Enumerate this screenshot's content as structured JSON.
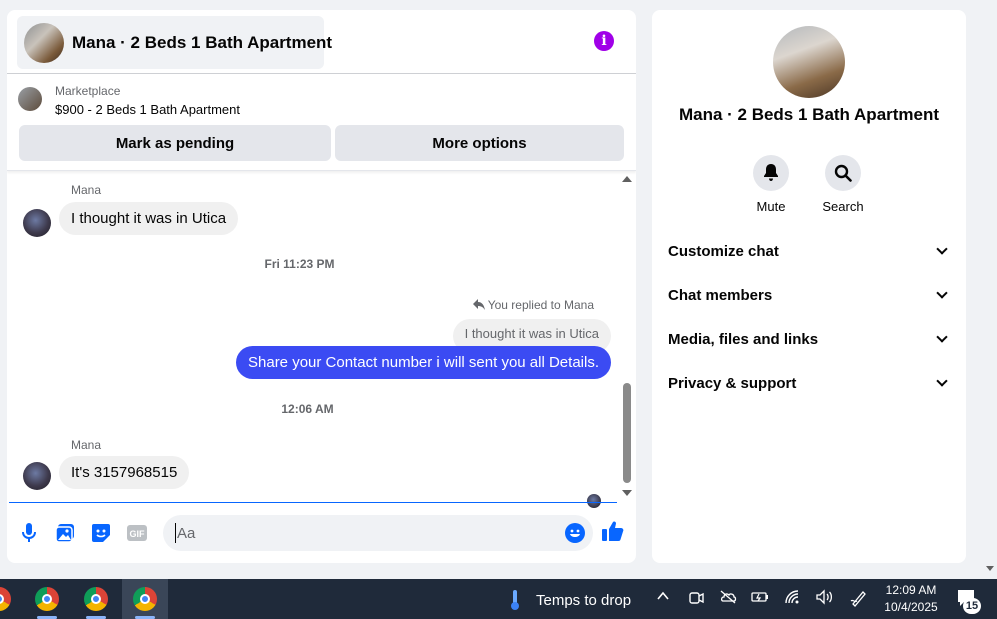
{
  "chat": {
    "title": "Mana · 2 Beds 1 Bath Apartment",
    "marketplace": {
      "label": "Marketplace",
      "item": "$900 - 2 Beds 1 Bath Apartment",
      "pending_button": "Mark as pending",
      "more_button": "More options"
    },
    "messages": {
      "msg1_sender": "Mana",
      "msg1_text": "I thought it was in Utica",
      "time1": "Fri 11:23 PM",
      "reply_note": "You replied to Mana",
      "reply_quote": "I thought it was in Utica",
      "outgoing_text": "Share your Contact number i will sent you all Details.",
      "time2": "12:06 AM",
      "msg2_sender": "Mana",
      "msg2_text": "It's 3157968515"
    },
    "composer": {
      "placeholder": "Aa"
    }
  },
  "details": {
    "title": "Mana · 2 Beds 1 Bath Apartment",
    "actions": [
      "Mute",
      "Search"
    ],
    "sections": [
      "Customize chat",
      "Chat members",
      "Media, files and links",
      "Privacy & support"
    ]
  },
  "taskbar": {
    "weather": "Temps to drop",
    "time": "12:09 AM",
    "date": "10/4/2025",
    "notification_count": "15"
  },
  "colors": {
    "accent": "#3b4bf3",
    "info": "#a000e8",
    "link": "#0866ff",
    "taskbar": "#1f2a3a"
  }
}
